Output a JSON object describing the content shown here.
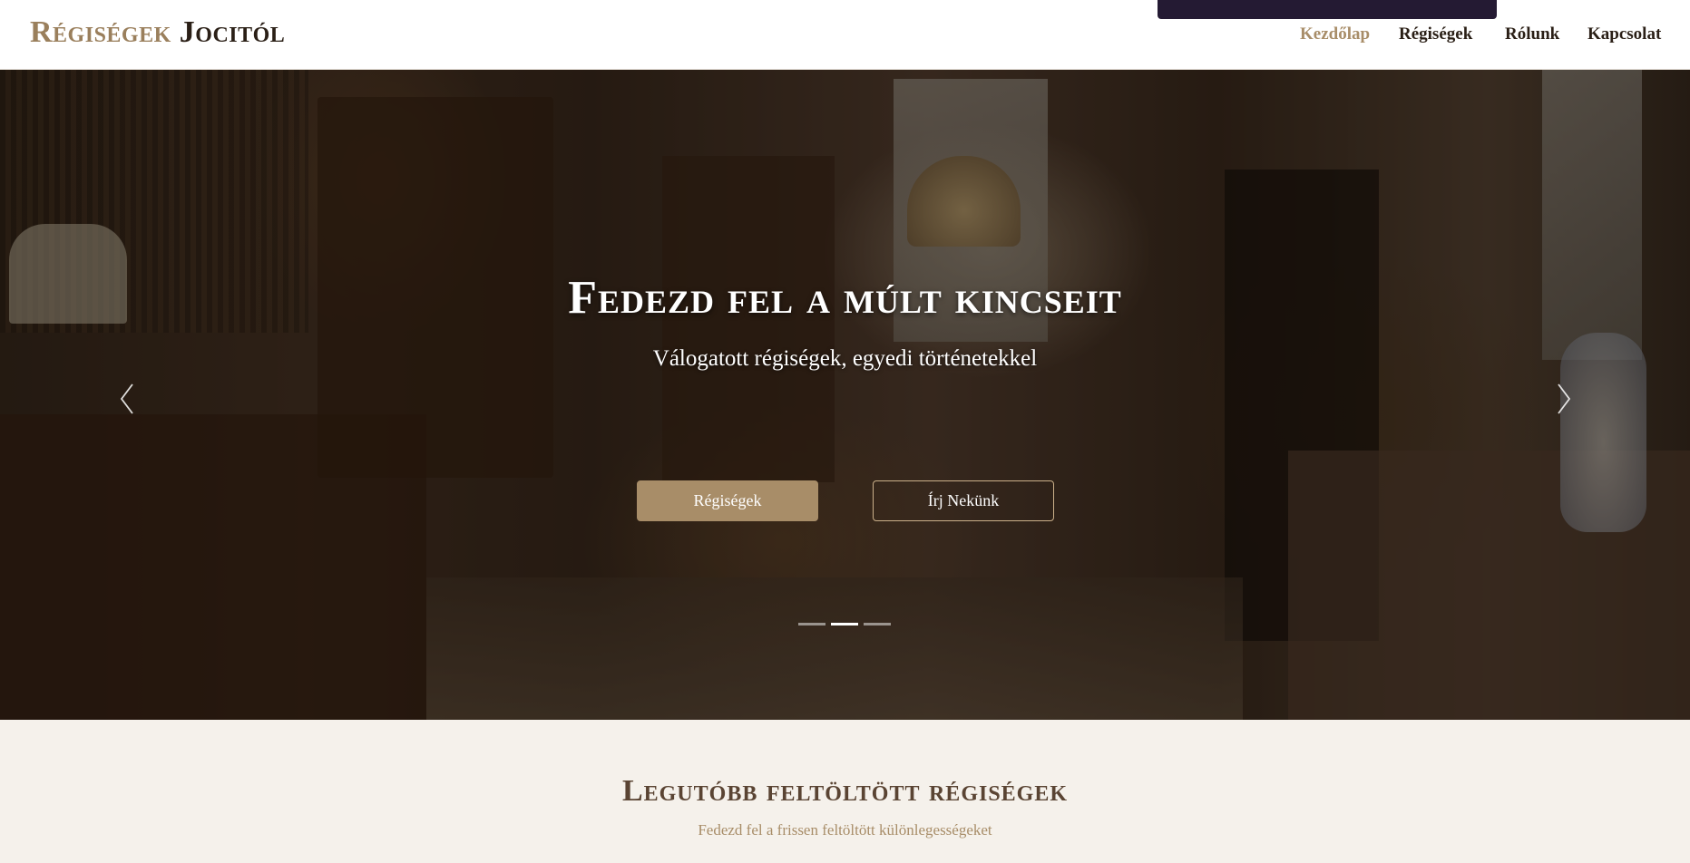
{
  "header": {
    "logo_part1": "Régiségek",
    "logo_part2": "Jocitól",
    "nav": [
      {
        "label": "Kezdőlap",
        "active": true
      },
      {
        "label": "Régiségek",
        "active": false
      },
      {
        "label": "Rólunk",
        "active": false
      },
      {
        "label": "Kapcsolat",
        "active": false
      }
    ]
  },
  "hero": {
    "title": "Fedezd fel a múlt kincseit",
    "subtitle": "Válogatott régiségek, egyedi történetekkel",
    "primary_button": "Régiségek",
    "secondary_button": "Írj Nekünk",
    "prev_icon": "chevron-left-icon",
    "next_icon": "chevron-right-icon",
    "slides_count": 3,
    "active_slide": 2
  },
  "latest": {
    "title": "Legutóbb feltöltött régiségek",
    "subtitle": "Fedezd fel a frissen feltöltött különlegességeket"
  },
  "colors": {
    "accent": "#a88d68",
    "dark_text": "#2a1f16",
    "section_bg": "#f5f1eb"
  }
}
